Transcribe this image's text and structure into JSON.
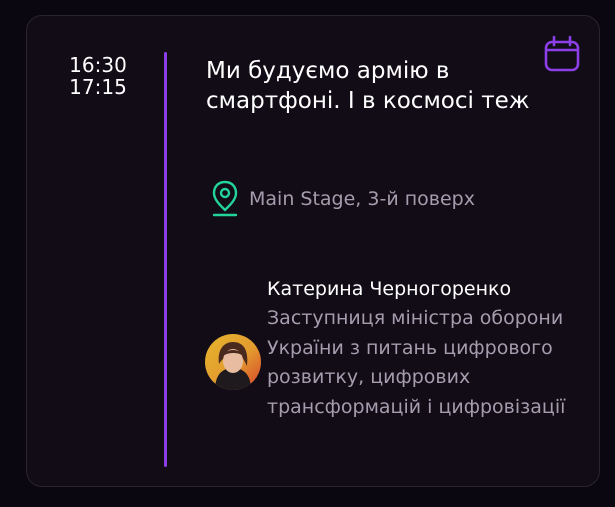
{
  "session": {
    "start_time": "16:30",
    "end_time": "17:15",
    "title": "Ми будуємо армію в смартфоні. І в космосі теж",
    "location": "Main Stage, 3-й поверх",
    "calendar_icon": "calendar-icon",
    "location_icon": "map-pin-icon"
  },
  "speaker": {
    "name": "Катерина Черногоренко",
    "role": "Заступниця міністра оборони України з питань цифрового розвитку, цифрових трансформацій і цифровізації"
  },
  "colors": {
    "accent": "#8b3fe6",
    "location_icon": "#23d39a",
    "background": "#0b0710",
    "card": "#120c17"
  }
}
